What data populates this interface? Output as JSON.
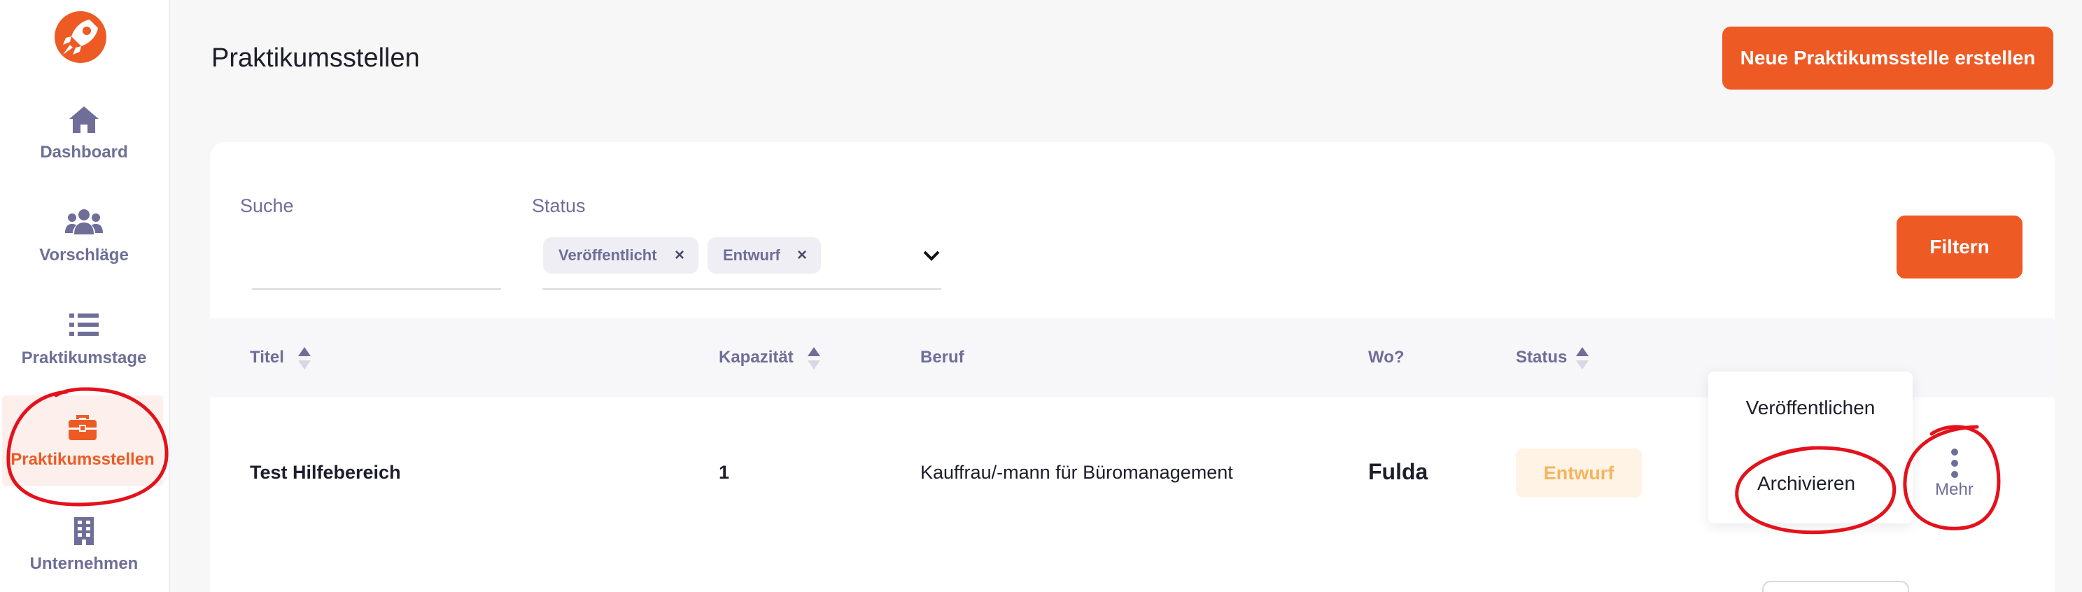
{
  "colors": {
    "accent": "#ee5a24",
    "sidebar_text": "#6e6e99",
    "draft_badge_bg": "#fff3e6",
    "draft_badge_text": "#f5b45f",
    "annotation": "#e3121b"
  },
  "sidebar": {
    "items": [
      {
        "label": "Dashboard",
        "icon": "home-icon"
      },
      {
        "label": "Vorschläge",
        "icon": "users-icon"
      },
      {
        "label": "Praktikumstage",
        "icon": "list-icon"
      },
      {
        "label": "Praktikumsstellen",
        "icon": "briefcase-icon",
        "active": true
      },
      {
        "label": "Unternehmen",
        "icon": "building-icon"
      }
    ]
  },
  "header": {
    "title": "Praktikumsstellen",
    "new_button": "Neue Praktikumsstelle erstellen"
  },
  "filters": {
    "search_label": "Suche",
    "search_value": "",
    "status_label": "Status",
    "status_chips": [
      "Veröffentlicht",
      "Entwurf"
    ],
    "filter_button": "Filtern"
  },
  "table": {
    "columns": [
      "Titel",
      "Kapazität",
      "Beruf",
      "Wo?",
      "Status"
    ],
    "rows": [
      {
        "titel": "Test Hilfebereich",
        "kapazitaet": "1",
        "beruf": "Kauffrau/-mann für Büromanagement",
        "wo": "Fulda",
        "status": "Entwurf",
        "more_label": "Mehr"
      }
    ]
  },
  "row_menu": {
    "items": [
      "Veröffentlichen",
      "Archivieren"
    ]
  }
}
